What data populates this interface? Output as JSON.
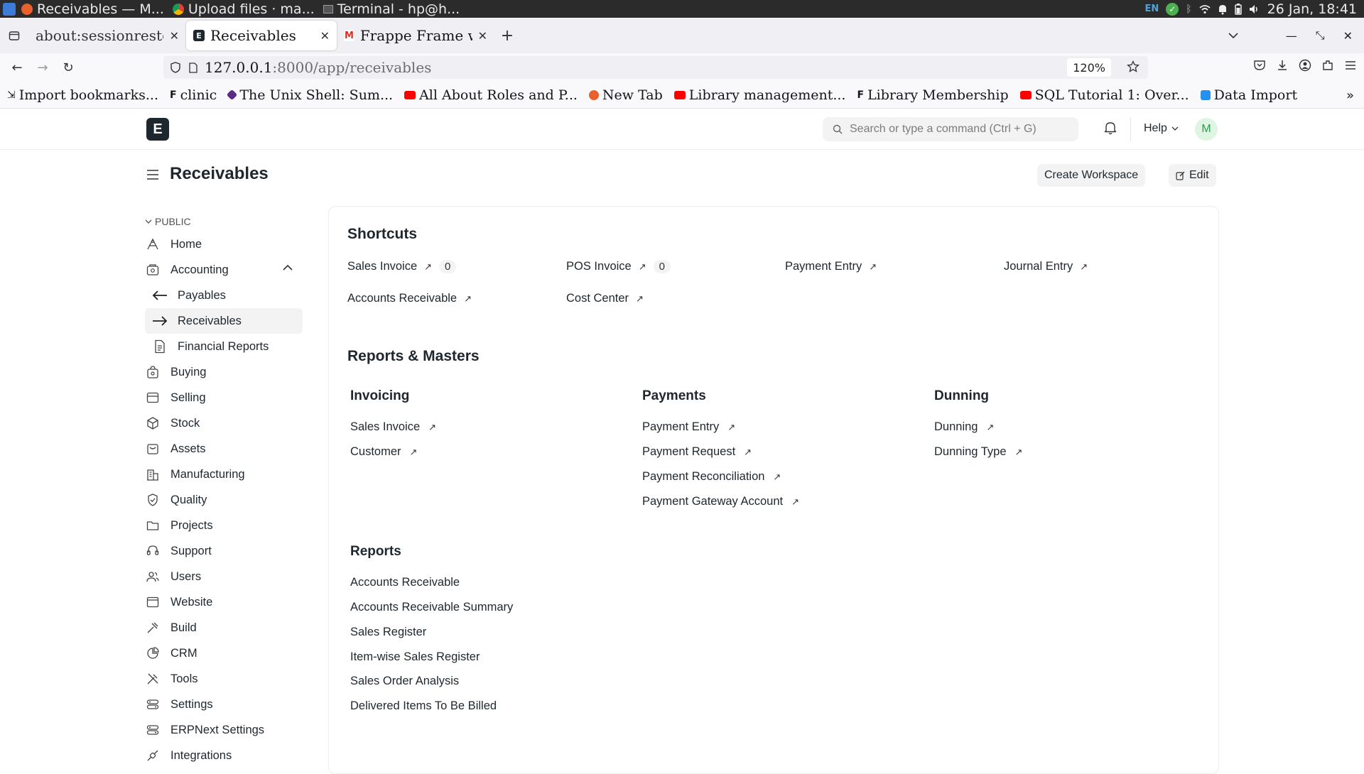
{
  "os": {
    "tasks": [
      "Receivables — M...",
      "Upload files · ma...",
      "Terminal - hp@h..."
    ],
    "lang": "EN",
    "datetime": "26 Jan, 18:41"
  },
  "browser": {
    "tabs": [
      {
        "label": "about:sessionrestore"
      },
      {
        "label": "Receivables"
      },
      {
        "label": "Frappe Frame wo"
      }
    ],
    "url_host": "127.0.0.1",
    "url_path": ":8000/app/receivables",
    "zoom": "120%",
    "bookmarks": [
      "Import bookmarks...",
      "clinic",
      "The Unix Shell: Sum...",
      "All About Roles and P...",
      "New Tab",
      "Library management...",
      "Library Membership",
      "SQL Tutorial 1: Over...",
      "Data Import"
    ]
  },
  "header": {
    "logo": "E",
    "search_placeholder": "Search or type a command (Ctrl + G)",
    "help": "Help",
    "avatar": "M"
  },
  "page": {
    "title": "Receivables",
    "create_workspace": "Create Workspace",
    "edit": "Edit"
  },
  "sidebar": {
    "section": "PUBLIC",
    "items": [
      {
        "label": "Home",
        "icon": "home-icon"
      },
      {
        "label": "Accounting",
        "icon": "accounting-icon"
      },
      {
        "label": "Payables",
        "icon": "arrow-left-icon"
      },
      {
        "label": "Receivables",
        "icon": "arrow-right-icon"
      },
      {
        "label": "Financial Reports",
        "icon": "document-icon"
      },
      {
        "label": "Buying",
        "icon": "buying-icon"
      },
      {
        "label": "Selling",
        "icon": "selling-icon"
      },
      {
        "label": "Stock",
        "icon": "stock-icon"
      },
      {
        "label": "Assets",
        "icon": "assets-icon"
      },
      {
        "label": "Manufacturing",
        "icon": "manufacturing-icon"
      },
      {
        "label": "Quality",
        "icon": "quality-icon"
      },
      {
        "label": "Projects",
        "icon": "folder-icon"
      },
      {
        "label": "Support",
        "icon": "support-icon"
      },
      {
        "label": "Users",
        "icon": "users-icon"
      },
      {
        "label": "Website",
        "icon": "website-icon"
      },
      {
        "label": "Build",
        "icon": "build-icon"
      },
      {
        "label": "CRM",
        "icon": "crm-icon"
      },
      {
        "label": "Tools",
        "icon": "tools-icon"
      },
      {
        "label": "Settings",
        "icon": "settings-icon"
      },
      {
        "label": "ERPNext Settings",
        "icon": "settings-icon"
      },
      {
        "label": "Integrations",
        "icon": "integrations-icon"
      }
    ]
  },
  "shortcuts": {
    "title": "Shortcuts",
    "items": [
      {
        "label": "Sales Invoice",
        "count": "0"
      },
      {
        "label": "POS Invoice",
        "count": "0"
      },
      {
        "label": "Payment Entry"
      },
      {
        "label": "Journal Entry"
      },
      {
        "label": "Accounts Receivable"
      },
      {
        "label": "Cost Center"
      }
    ]
  },
  "reports_masters": {
    "title": "Reports & Masters",
    "invoicing": {
      "title": "Invoicing",
      "links": [
        "Sales Invoice",
        "Customer"
      ]
    },
    "payments": {
      "title": "Payments",
      "links": [
        "Payment Entry",
        "Payment Request",
        "Payment Reconciliation",
        "Payment Gateway Account"
      ]
    },
    "dunning": {
      "title": "Dunning",
      "links": [
        "Dunning",
        "Dunning Type"
      ]
    },
    "reports": {
      "title": "Reports",
      "links": [
        "Accounts Receivable",
        "Accounts Receivable Summary",
        "Sales Register",
        "Item-wise Sales Register",
        "Sales Order Analysis",
        "Delivered Items To Be Billed"
      ]
    }
  }
}
